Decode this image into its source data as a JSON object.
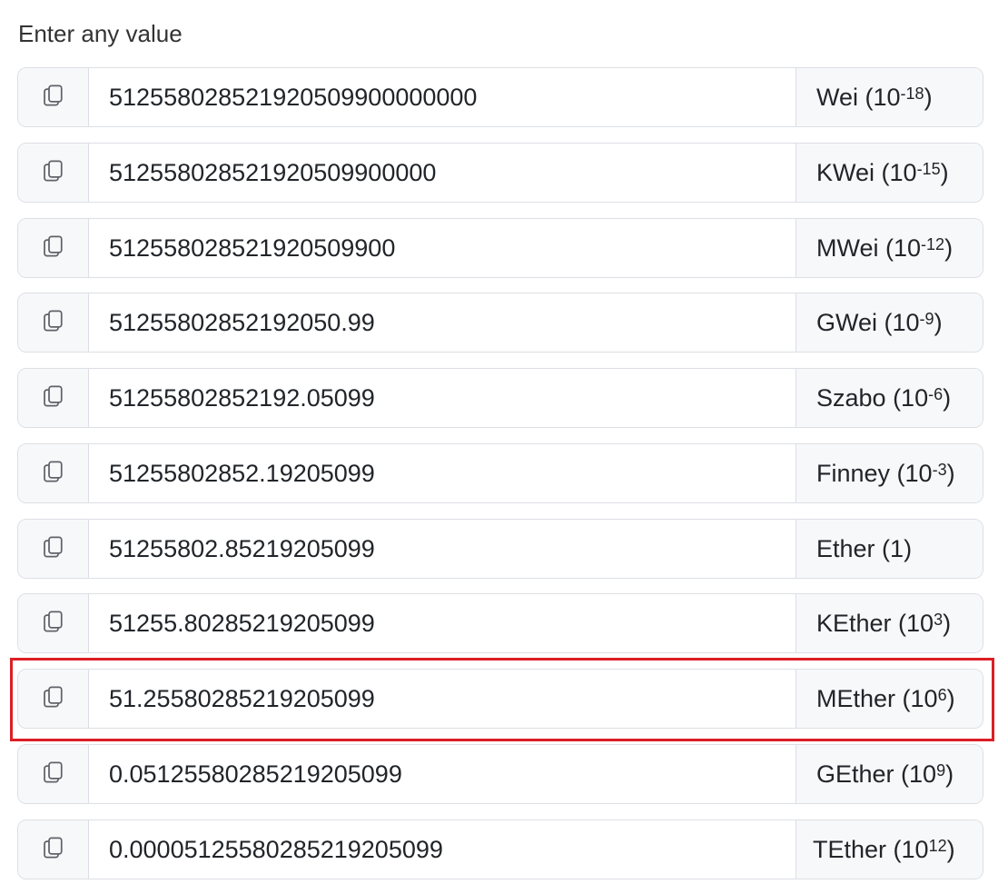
{
  "heading": "Enter any value",
  "highlight_color": "#dc1f26",
  "copy_icon": "copy-icon",
  "units": [
    {
      "id": "wei",
      "value": "512558028521920509900000000",
      "unit_name": "Wei",
      "exponent": "-18"
    },
    {
      "id": "kwei",
      "value": "512558028521920509900000",
      "unit_name": "KWei",
      "exponent": "-15"
    },
    {
      "id": "mwei",
      "value": "512558028521920509900",
      "unit_name": "MWei",
      "exponent": "-12"
    },
    {
      "id": "gwei",
      "value": "51255802852192050.99",
      "unit_name": "GWei",
      "exponent": "-9"
    },
    {
      "id": "szabo",
      "value": "51255802852192.05099",
      "unit_name": "Szabo",
      "exponent": "-6"
    },
    {
      "id": "finney",
      "value": "51255802852.19205099",
      "unit_name": "Finney",
      "exponent": "-3"
    },
    {
      "id": "ether",
      "value": "51255802.85219205099",
      "unit_name": "Ether",
      "exponent": "",
      "factor": "1"
    },
    {
      "id": "kether",
      "value": "51255.80285219205099",
      "unit_name": "KEther",
      "exponent": "3"
    },
    {
      "id": "mether",
      "value": "51.25580285219205099",
      "unit_name": "MEther",
      "exponent": "6"
    },
    {
      "id": "gether",
      "value": "0.05125580285219205099",
      "unit_name": "GEther",
      "exponent": "9"
    },
    {
      "id": "tether",
      "value": "0.00005125580285219205099",
      "unit_name": "TEther",
      "exponent": "12"
    }
  ]
}
